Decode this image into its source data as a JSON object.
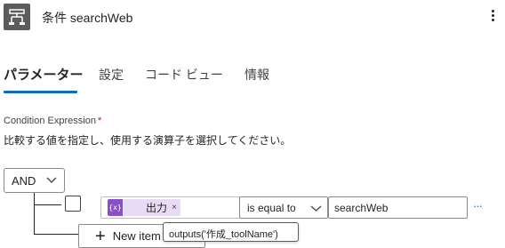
{
  "header": {
    "title": "条件 searchWeb",
    "icon": "condition-icon"
  },
  "tabs": [
    {
      "label": "パラメーター",
      "active": true
    },
    {
      "label": "設定",
      "active": false
    },
    {
      "label": "コード ビュー",
      "active": false
    },
    {
      "label": "情報",
      "active": false
    }
  ],
  "condition": {
    "label": "Condition Expression",
    "required_mark": "*",
    "description": "比較する値を指定し、使用する演算子を選択してください。",
    "group_operator": "AND",
    "row": {
      "left_token_icon": "{x}",
      "left_token_label": "出力",
      "left_token_remove": "×",
      "operator": "is equal to",
      "right_value": "searchWeb",
      "more": "···"
    },
    "add_item_label": "New item",
    "add_item_symbol": "+"
  },
  "tooltip": {
    "text": "outputs('作成_toolName')"
  },
  "colors": {
    "accent": "#0f6cbd",
    "token_bg": "#e7dcf4",
    "token_icon": "#8a4fc6",
    "header_icon_bg": "#5c5c5c",
    "required": "#c50f1f"
  }
}
